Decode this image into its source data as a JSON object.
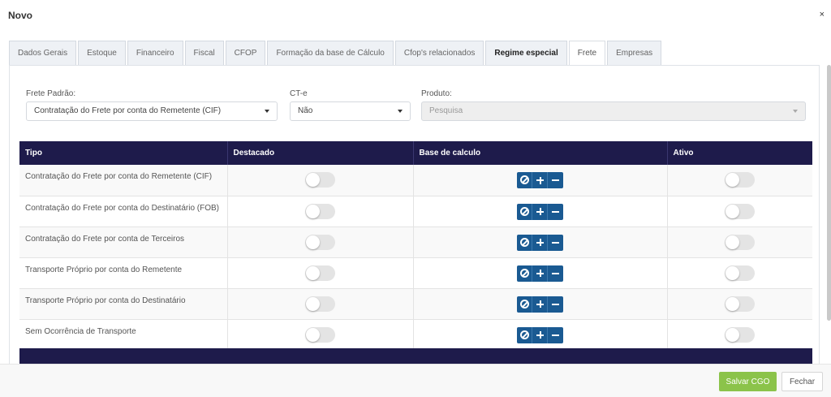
{
  "modal": {
    "title": "Novo",
    "close_label": "×"
  },
  "tabs": [
    {
      "label": "Dados Gerais",
      "active": false
    },
    {
      "label": "Estoque",
      "active": false
    },
    {
      "label": "Financeiro",
      "active": false
    },
    {
      "label": "Fiscal",
      "active": false
    },
    {
      "label": "CFOP",
      "active": false
    },
    {
      "label": "Formação da base de Cálculo",
      "active": false
    },
    {
      "label": "Cfop's relacionados",
      "active": false
    },
    {
      "label": "Regime especial",
      "active": false
    },
    {
      "label": "Frete",
      "active": true
    },
    {
      "label": "Empresas",
      "active": false
    }
  ],
  "form": {
    "frete_padrao": {
      "label": "Frete Padrão:",
      "value": "Contratação do Frete por conta do Remetente (CIF)"
    },
    "cte": {
      "label": "CT-e",
      "value": "Não"
    },
    "produto": {
      "label": "Produto:",
      "placeholder": "Pesquisa"
    }
  },
  "table": {
    "headers": [
      "Tipo",
      "Destacado",
      "Base de calculo",
      "Ativo"
    ],
    "rows": [
      {
        "tipo": "Contratação do Frete por conta do Remetente (CIF)",
        "destacado": false,
        "ativo": false
      },
      {
        "tipo": "Contratação do Frete por conta do Destinatário (FOB)",
        "destacado": false,
        "ativo": false
      },
      {
        "tipo": "Contratação do Frete por conta de Terceiros",
        "destacado": false,
        "ativo": false
      },
      {
        "tipo": "Transporte Próprio por conta do Remetente",
        "destacado": false,
        "ativo": false
      },
      {
        "tipo": "Transporte Próprio por conta do Destinatário",
        "destacado": false,
        "ativo": false
      },
      {
        "tipo": "Sem Ocorrência de Transporte",
        "destacado": false,
        "ativo": false
      }
    ]
  },
  "footer": {
    "save_label": "Salvar CGO",
    "close_label": "Fechar"
  },
  "colors": {
    "header_bg": "#1e1b4b",
    "action_btn": "#1a5a92",
    "save_btn": "#8bc34a"
  }
}
